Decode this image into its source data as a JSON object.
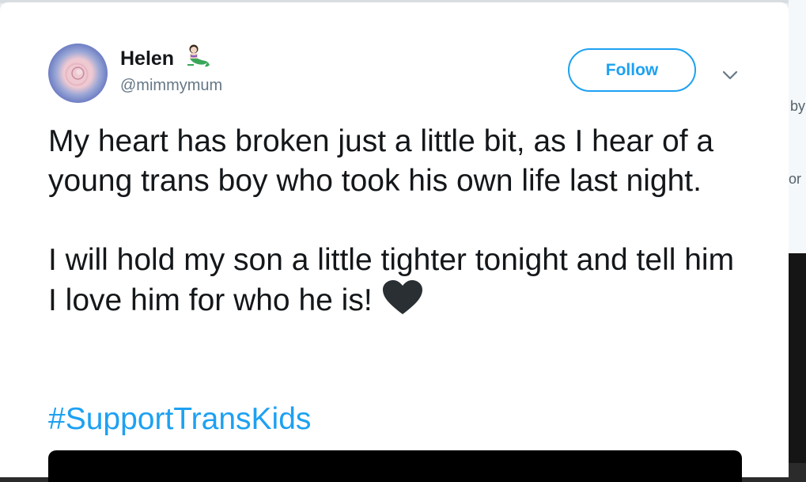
{
  "background": {
    "snippet_1": "by",
    "snippet_2": "or"
  },
  "tweet": {
    "display_name": "Helen",
    "display_name_emoji": "mermaid-emoji",
    "handle": "@mimmymum",
    "follow_label": "Follow",
    "menu_icon": "chevron-down-icon",
    "paragraph_1": "My heart has broken just a little bit, as I hear of a young trans boy who took his own life last night.",
    "paragraph_2": "I will hold my son a little tighter tonight and tell him I love him for who he is!",
    "heart_icon": "black-heart-icon",
    "hashtag": "#SupportTransKids"
  },
  "colors": {
    "accent": "#1da1f2",
    "text": "#14171a",
    "secondary_text": "#657786"
  }
}
